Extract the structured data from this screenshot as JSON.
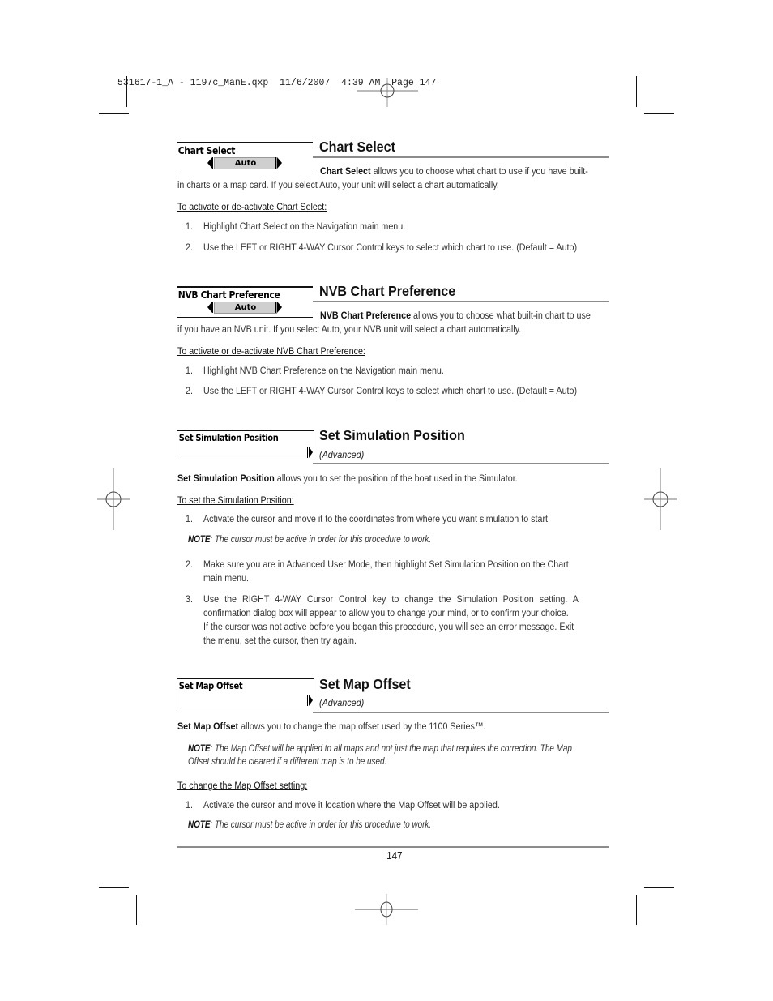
{
  "slug": "531617-1_A - 1197c_ManE.qxp  11/6/2007  4:39 AM  Page 147",
  "sections": {
    "chart_select": {
      "menu_label": "Chart Select",
      "menu_value": "Auto",
      "title": "Chart Select",
      "intro_bold": "Chart Select",
      "intro_line1": " allows you to choose what chart to use if you have built-",
      "intro_line2": "in charts or a map card. If you select Auto, your unit will select a chart automatically.",
      "subheading": "To activate or de-activate Chart Select:",
      "steps": [
        {
          "num": "1.",
          "text": "Highlight Chart Select on the Navigation main menu."
        },
        {
          "num": "2.",
          "text": "Use the LEFT or RIGHT 4-WAY Cursor Control keys to select which chart to use. (Default = Auto)"
        }
      ]
    },
    "nvb_chart_preference": {
      "menu_label": "NVB Chart Preference",
      "menu_value": "Auto",
      "title": "NVB Chart Preference",
      "intro_bold": "NVB Chart Preference",
      "intro_line1": " allows you to choose what built-in chart to use",
      "intro_line2": "if you have an NVB unit. If you select Auto, your NVB unit will select a chart automatically.",
      "subheading": "To activate or de-activate NVB Chart Preference:",
      "steps": [
        {
          "num": "1.",
          "text": "Highlight NVB Chart Preference on the Navigation main menu."
        },
        {
          "num": "2.",
          "text": "Use the LEFT or RIGHT 4-WAY Cursor Control keys to select which chart to use. (Default = Auto)"
        }
      ]
    },
    "set_simulation_position": {
      "menu_label": "Set Simulation Position",
      "title": "Set Simulation Position",
      "tag": "(Advanced)",
      "intro_bold": "Set Simulation Position",
      "intro_rest": " allows you to set the position of the boat used in the Simulator.",
      "subheading": "To set the Simulation Position:",
      "steps": [
        {
          "num": "1.",
          "text": "Activate the cursor and move it to the coordinates from where you want simulation to start."
        },
        {
          "num": "2.",
          "line1": "Make sure you are in Advanced User Mode, then highlight Set Simulation Position on the Chart",
          "line2": "main menu."
        },
        {
          "num": "3.",
          "line1": "Use the RIGHT 4-WAY Cursor Control key to change the Simulation Position setting. A",
          "line2": "confirmation dialog box will appear to allow you to change your mind, or to confirm your choice.",
          "line3": "If the cursor was not active before you began this procedure, you will see an error message. Exit",
          "line4": "the menu, set the cursor, then try again."
        }
      ],
      "note_label": "NOTE",
      "note_text": ": The cursor must be active in order for this procedure to work."
    },
    "set_map_offset": {
      "menu_label": "Set Map Offset",
      "title": "Set Map Offset",
      "tag": "(Advanced)",
      "intro_bold": "Set Map Offset",
      "intro_rest": " allows you to change the map offset used by the 1100 Series™.",
      "note1_label": "NOTE",
      "note1_line1": ": The Map Offset will be applied to all maps and not just the map that requires the correction. The Map",
      "note1_line2": "Offset should be cleared if a different map is to be used.",
      "subheading": "To change the Map Offset setting:",
      "steps": [
        {
          "num": "1.",
          "text": "Activate the cursor and move it location where the Map Offset will be applied."
        }
      ],
      "note2_label": "NOTE",
      "note2_text": ": The cursor must be active in order for this procedure to work."
    }
  },
  "footer": {
    "page_number": "147"
  }
}
